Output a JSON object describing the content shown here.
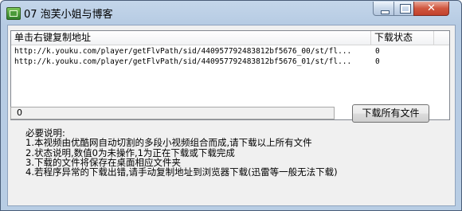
{
  "window": {
    "title": "07 泡芙小姐与博客"
  },
  "titlebar": {
    "close_glyph": "✕"
  },
  "list": {
    "headers": {
      "url": "单击右键复制地址",
      "status": "下载状态"
    },
    "rows": [
      {
        "url": "http://k.youku.com/player/getFlvPath/sid/440957792483812bf5676_00/st/fl...",
        "status": "0"
      },
      {
        "url": "http://k.youku.com/player/getFlvPath/sid/440957792483812bf5676_01/st/fl...",
        "status": "0"
      }
    ]
  },
  "status_field": {
    "value": "0"
  },
  "download_all_button": {
    "label": "下载所有文件"
  },
  "notes": {
    "heading": "必要说明:",
    "lines": [
      "1.本视频由优酷网自动切割的多段小视频组合而成,请下载以上所有文件",
      "2.状态说明,数值0为未操作,1为正在下载或下载完成",
      "3.下载的文件将保存在桌面相应文件夹",
      "4.若程序异常的下载出错,请手动复制地址到浏览器下载(迅雷等一般无法下载)"
    ]
  }
}
